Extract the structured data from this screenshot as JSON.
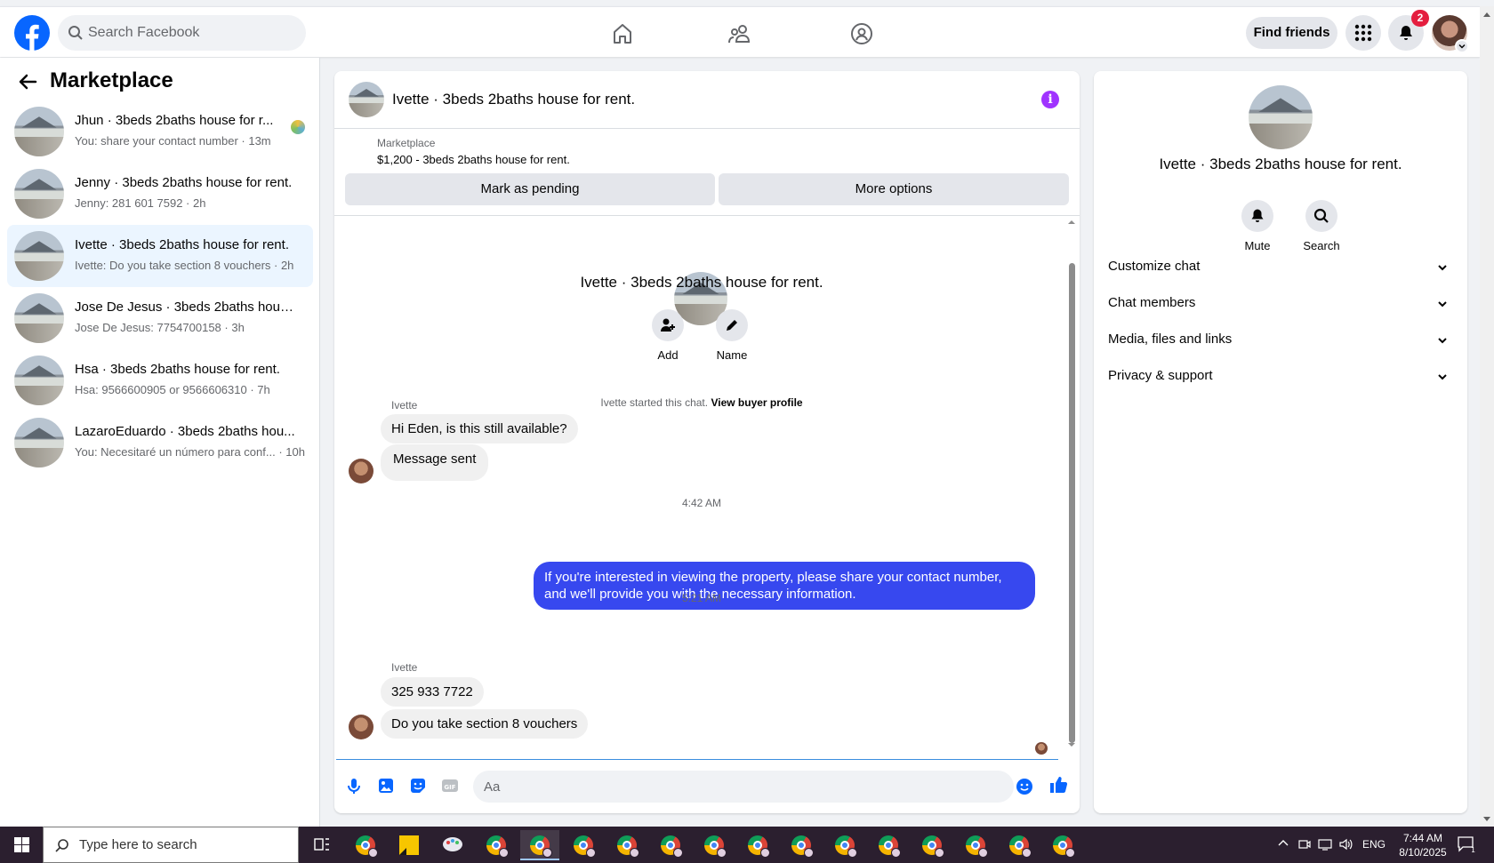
{
  "topbar": {
    "search_placeholder": "Search Facebook",
    "find_friends": "Find friends",
    "notification_count": "2",
    "brand_color": "#0866ff"
  },
  "sidebar": {
    "title": "Marketplace",
    "conversations": [
      {
        "title": "Jhun · 3beds 2baths house for r...",
        "preview": "You: share your contact number · 13m"
      },
      {
        "title": "Jenny · 3beds 2baths house for rent.",
        "preview": "Jenny: 281 601 7592 · 2h"
      },
      {
        "title": "Ivette · 3beds 2baths house for rent.",
        "preview": "Ivette: Do you take section 8 vouchers · 2h",
        "selected": true
      },
      {
        "title": "Jose De Jesus · 3beds 2baths hous...",
        "preview": "Jose De Jesus: 7754700158 · 3h"
      },
      {
        "title": "Hsa · 3beds 2baths house for rent.",
        "preview": "Hsa: 9566600905 or 9566606310 · 7h"
      },
      {
        "title": "LazaroEduardo · 3beds 2baths hou...",
        "preview": "You: Necesitaré un número para conf... · 10h"
      }
    ]
  },
  "chat": {
    "title": "Ivette · 3beds 2baths house for rent.",
    "listing_source": "Marketplace",
    "listing": "$1,200 - 3beds 2baths house for rent.",
    "mark_pending": "Mark as pending",
    "more_options": "More options",
    "intro_title": "Ivette · 3beds 2baths house for rent.",
    "add_label": "Add",
    "name_label": "Name",
    "started_text": "Ivette started this chat.",
    "view_profile": "View buyer profile",
    "messages": {
      "sender1": "Ivette",
      "m1": "Hi Eden, is this still available?",
      "m2": "Message sent",
      "time1": "4:42 AM",
      "out1": "If you're interested in viewing the property, please share your contact number, and we'll provide you with the necessary information.",
      "time2": "5:21 AM",
      "sender2": "Ivette",
      "m3": "325 933 7722",
      "m4": "Do you take section 8 vouchers"
    },
    "compose_placeholder": "Aa",
    "outgoing_color": "#3748ef"
  },
  "details": {
    "title": "Ivette · 3beds 2baths house for rent.",
    "mute": "Mute",
    "search": "Search",
    "sections": [
      "Customize chat",
      "Chat members",
      "Media, files and links",
      "Privacy & support"
    ]
  },
  "taskbar": {
    "search_placeholder": "Type here to search",
    "lang": "ENG",
    "time": "7:44 AM",
    "date": "8/10/2025"
  }
}
